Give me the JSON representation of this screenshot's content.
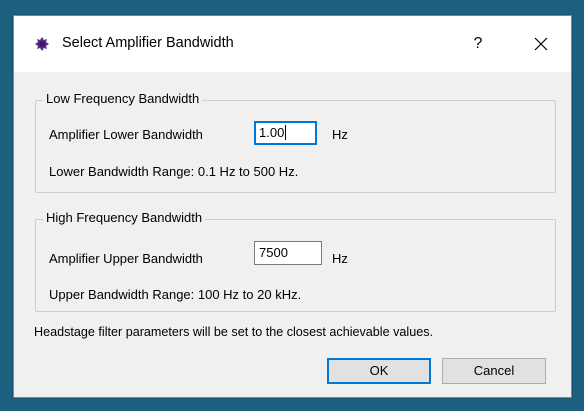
{
  "dialog": {
    "title": "Select Amplifier Bandwidth",
    "help_label": "?",
    "close_icon": "close-icon",
    "app_icon": "app-logo-icon"
  },
  "low_group": {
    "title": "Low Frequency Bandwidth",
    "field_label": "Amplifier Lower Bandwidth",
    "field_value": "1.00",
    "unit": "Hz",
    "range_text": "Lower Bandwidth Range: 0.1 Hz to 500 Hz."
  },
  "high_group": {
    "title": "High Frequency Bandwidth",
    "field_label": "Amplifier Upper Bandwidth",
    "field_value": "7500",
    "unit": "Hz",
    "range_text": "Upper Bandwidth Range: 100 Hz to 20 kHz."
  },
  "note": "Headstage filter parameters will be set to the closest achievable values.",
  "buttons": {
    "ok": "OK",
    "cancel": "Cancel"
  },
  "colors": {
    "desktop": "#1d5f7e",
    "dialog_bg": "#f0f0f0",
    "focus": "#0078d7"
  }
}
